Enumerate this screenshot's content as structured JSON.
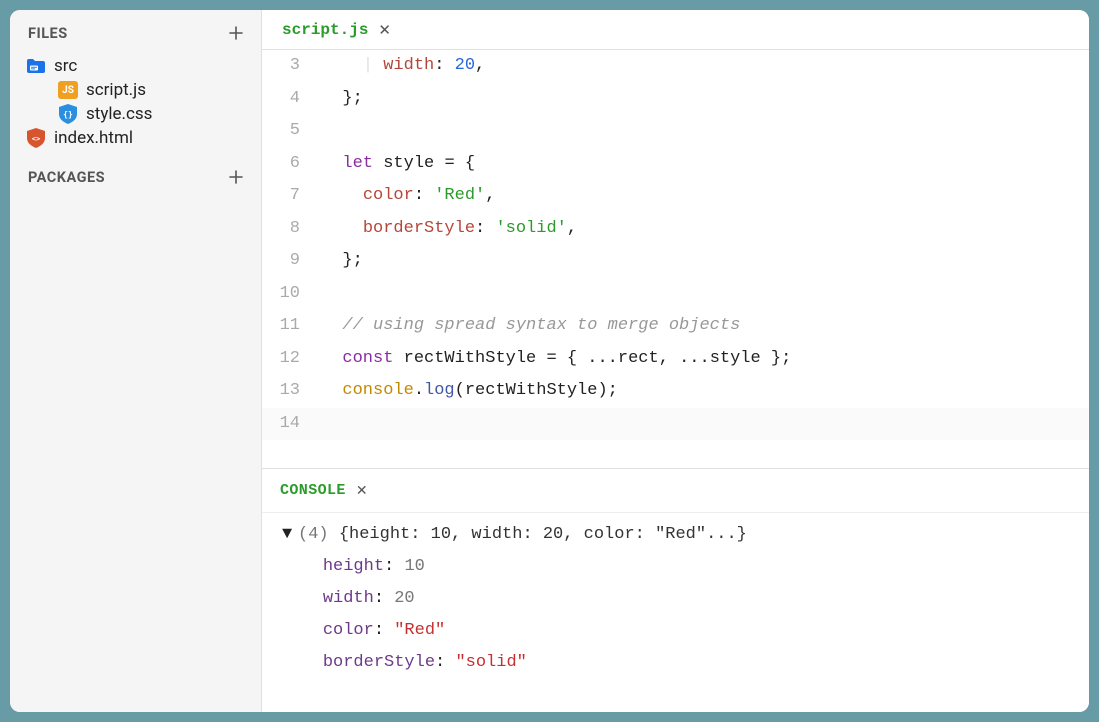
{
  "sidebar": {
    "files_label": "FILES",
    "packages_label": "PACKAGES",
    "tree": [
      {
        "name": "src",
        "type": "folder",
        "depth": 0
      },
      {
        "name": "script.js",
        "type": "js",
        "depth": 1
      },
      {
        "name": "style.css",
        "type": "css",
        "depth": 1
      },
      {
        "name": "index.html",
        "type": "html",
        "depth": 0
      }
    ]
  },
  "tab": {
    "label": "script.js"
  },
  "editor": {
    "first_line_number": 3,
    "active_line_number": 14,
    "lines": [
      {
        "indent": 2,
        "tokens": [
          [
            "indent-guide",
            "| "
          ],
          [
            "prop",
            "width"
          ],
          [
            "punc",
            ": "
          ],
          [
            "num",
            "20"
          ],
          [
            "punc",
            ","
          ]
        ]
      },
      {
        "indent": 1,
        "tokens": [
          [
            "punc",
            "};"
          ]
        ]
      },
      {
        "indent": 1,
        "tokens": []
      },
      {
        "indent": 1,
        "tokens": [
          [
            "kw",
            "let"
          ],
          [
            "id",
            " style "
          ],
          [
            "punc",
            "= {"
          ]
        ]
      },
      {
        "indent": 2,
        "tokens": [
          [
            "prop",
            "color"
          ],
          [
            "punc",
            ": "
          ],
          [
            "str",
            "'Red'"
          ],
          [
            "punc",
            ","
          ]
        ]
      },
      {
        "indent": 2,
        "tokens": [
          [
            "prop",
            "borderStyle"
          ],
          [
            "punc",
            ": "
          ],
          [
            "str",
            "'solid'"
          ],
          [
            "punc",
            ","
          ]
        ]
      },
      {
        "indent": 1,
        "tokens": [
          [
            "punc",
            "};"
          ]
        ]
      },
      {
        "indent": 1,
        "tokens": []
      },
      {
        "indent": 1,
        "tokens": [
          [
            "comment",
            "// using spread syntax to merge objects"
          ]
        ]
      },
      {
        "indent": 1,
        "tokens": [
          [
            "kw",
            "const"
          ],
          [
            "id",
            " rectWithStyle "
          ],
          [
            "punc",
            "= { ..."
          ],
          [
            "id",
            "rect"
          ],
          [
            "punc",
            ", ..."
          ],
          [
            "id",
            "style"
          ],
          [
            "punc",
            " };"
          ]
        ]
      },
      {
        "indent": 1,
        "tokens": [
          [
            "obj",
            "console"
          ],
          [
            "punc",
            "."
          ],
          [
            "fn",
            "log"
          ],
          [
            "punc",
            "("
          ],
          [
            "id",
            "rectWithStyle"
          ],
          [
            "punc",
            ");"
          ]
        ]
      },
      {
        "indent": 1,
        "tokens": []
      }
    ]
  },
  "console": {
    "title": "CONSOLE",
    "summary_count": "(4)",
    "summary_text": "{height: 10, width: 20, color: \"Red\"...}",
    "entries": [
      {
        "key": "height",
        "value": "10",
        "kind": "num"
      },
      {
        "key": "width",
        "value": "20",
        "kind": "num"
      },
      {
        "key": "color",
        "value": "\"Red\"",
        "kind": "str"
      },
      {
        "key": "borderStyle",
        "value": "\"solid\"",
        "kind": "str"
      }
    ]
  }
}
